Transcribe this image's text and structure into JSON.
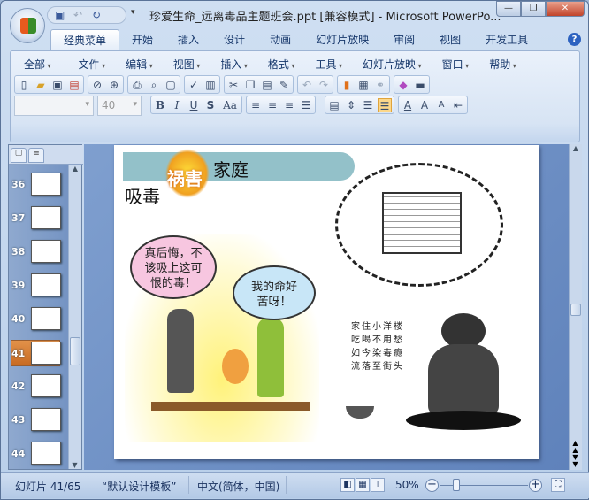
{
  "window": {
    "title": "珍爱生命_远离毒品主题班会.ppt [兼容模式] - Microsoft PowerPo...",
    "minimize": "—",
    "restore": "❐",
    "close": "✕"
  },
  "tabs": [
    "经典菜单",
    "开始",
    "插入",
    "设计",
    "动画",
    "幻灯片放映",
    "审阅",
    "视图",
    "开发工具"
  ],
  "help": "?",
  "menus": [
    "全部",
    "文件",
    "编辑",
    "视图",
    "插入",
    "格式",
    "工具",
    "幻灯片放映",
    "窗口",
    "帮助"
  ],
  "format": {
    "font_name": "",
    "font_size": "40",
    "bold": "B",
    "italic": "I",
    "underline": "U",
    "shadow": "S",
    "change_case": "Aa"
  },
  "thumbnails": [
    {
      "num": "36"
    },
    {
      "num": "37"
    },
    {
      "num": "38"
    },
    {
      "num": "39"
    },
    {
      "num": "40"
    },
    {
      "num": "41",
      "selected": true
    },
    {
      "num": "42"
    },
    {
      "num": "43"
    },
    {
      "num": "44"
    }
  ],
  "slide": {
    "title_parts": [
      "吸毒",
      "祸害",
      "家庭"
    ],
    "bubble_father": "真后悔，不该吸上这可恨的毒！",
    "bubble_mother": "我的命好苦呀！",
    "caption": [
      "家住小洋楼",
      "吃喝不用愁",
      "如今染毒瘾",
      "流落至街头"
    ]
  },
  "status": {
    "slide": "幻灯片 41/65",
    "template": "“默认设计模板”",
    "language": "中文(简体，中国)",
    "zoom": "50%",
    "zoom_level": 50
  }
}
